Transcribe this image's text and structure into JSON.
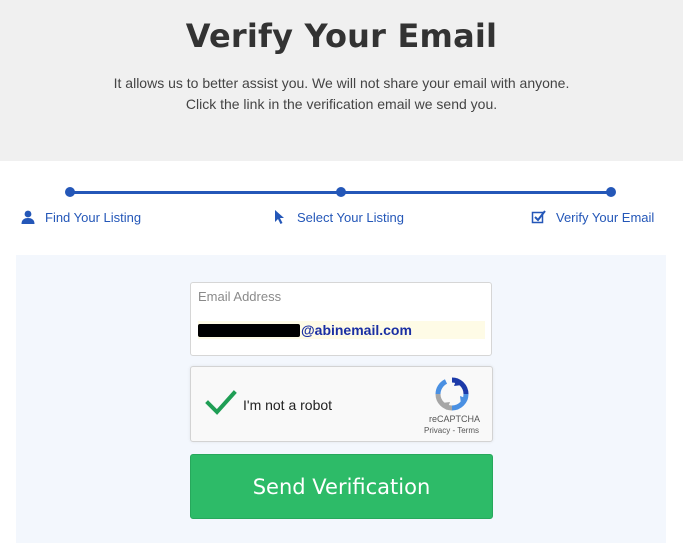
{
  "header": {
    "title": "Verify Your Email",
    "subtitle_line1": "It allows us to better assist you. We will not share your email with anyone.",
    "subtitle_line2": "Click the link in the verification email we send you."
  },
  "steps": [
    {
      "label": "Find Your Listing",
      "icon": "user-icon"
    },
    {
      "label": "Select Your Listing",
      "icon": "cursor-icon"
    },
    {
      "label": "Verify Your Email",
      "icon": "checkbox-icon"
    }
  ],
  "colors": {
    "accent": "#2457b8",
    "button": "#2dbb68",
    "panel": "#f3f7fd"
  },
  "form": {
    "email_label": "Email Address",
    "email_value": "@abinemail.com",
    "captcha_label": "I'm not a robot",
    "captcha_brand": "reCAPTCHA",
    "captcha_terms": "Privacy - Terms",
    "submit_label": "Send Verification"
  }
}
